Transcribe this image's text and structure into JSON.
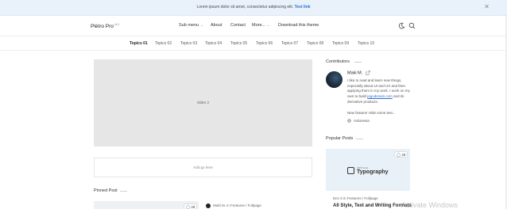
{
  "notice": {
    "text": "Lorem ipsum dolor sit amet, consectetur adipiscing elit.",
    "link": "Test link",
    "close_glyph": "✕"
  },
  "header": {
    "logo": "Plétro Pro",
    "version": "v6.1",
    "nav": [
      {
        "label": "Sub menu",
        "has_dropdown": true
      },
      {
        "label": "About"
      },
      {
        "label": "Contact"
      },
      {
        "label": "More...",
        "has_dropdown": true
      },
      {
        "label": "Download this theme"
      }
    ],
    "icons": [
      "dark-mode-icon",
      "search-icon"
    ]
  },
  "topics": [
    "Topics 01",
    "Topics 02",
    "Topics 03",
    "Topics 04",
    "Topics 05",
    "Topics 06",
    "Topics 07",
    "Topics 08",
    "Topics 09",
    "Topics 10"
  ],
  "active_topic": "Topics 01",
  "main": {
    "slider_label": "Slider 2",
    "ad_label": "Add go here",
    "pinned_title": "Pinned Post",
    "pinned_comments": "28",
    "pinned_author": "Maki M.",
    "pinned_in": "in",
    "pinned_categories": "Features / Fullpage"
  },
  "sidebar": {
    "contributors_title": "Contributors",
    "author_name": "Maki M.",
    "bio_text": "I like to read and learn new things, especially about UI and UX and then applying them in my work. I work on my own to build",
    "bio_link": "jagodesain.com",
    "bio_end": "and its derivative products.",
    "bio_extra": "New feature! Hide some text...",
    "location": "Indonesia",
    "popular_title": "Popular Posts",
    "popular_comments": "28",
    "popular_thumb_small": "ARTICLE",
    "popular_thumb_title": "Typography",
    "popular_date": "Dec 5",
    "popular_in": "in",
    "popular_categories": "Features / Fullpage",
    "popular_post_title": "All Style, Text and Writing Formats"
  },
  "watermark": "Activate Windows",
  "colors": {
    "notice_bg": "#e9f2fb",
    "link": "#2d6fd4",
    "slider_bg": "#e6e6e6",
    "thumb_bg": "#e9f1f8"
  }
}
